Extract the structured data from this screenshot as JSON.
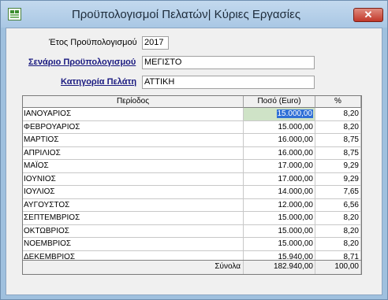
{
  "window": {
    "title": "Προϋπολογισμοί Πελατών| Κύριες Εργασίες",
    "close_glyph": "✕"
  },
  "form": {
    "year_label": "Έτος Προϋπολογισμού",
    "year_value": "2017",
    "scenario_label": "Σενάριο Προϋπολογισμού",
    "scenario_value": "ΜΕΓΙΣΤΟ",
    "category_label": "Κατηγορία Πελάτη",
    "category_value": "ΑΤΤΙΚΗ"
  },
  "grid": {
    "headers": {
      "period": "Περίοδος",
      "amount": "Ποσό (Euro)",
      "pct": "%"
    },
    "rows": [
      {
        "period": "ΙΑΝΟΥΑΡΙΟΣ",
        "amount": "15.000,00",
        "pct": "8,20"
      },
      {
        "period": "ΦΕΒΡΟΥΑΡΙΟΣ",
        "amount": "15.000,00",
        "pct": "8,20"
      },
      {
        "period": "ΜΑΡΤΙΟΣ",
        "amount": "16.000,00",
        "pct": "8,75"
      },
      {
        "period": "ΑΠΡΙΛΙΟΣ",
        "amount": "16.000,00",
        "pct": "8,75"
      },
      {
        "period": "ΜΑΪΟΣ",
        "amount": "17.000,00",
        "pct": "9,29"
      },
      {
        "period": "ΙΟΥΝΙΟΣ",
        "amount": "17.000,00",
        "pct": "9,29"
      },
      {
        "period": "ΙΟΥΛΙΟΣ",
        "amount": "14.000,00",
        "pct": "7,65"
      },
      {
        "period": "ΑΥΓΟΥΣΤΟΣ",
        "amount": "12.000,00",
        "pct": "6,56"
      },
      {
        "period": "ΣΕΠΤΕΜΒΡΙΟΣ",
        "amount": "15.000,00",
        "pct": "8,20"
      },
      {
        "period": "ΟΚΤΩΒΡΙΟΣ",
        "amount": "15.000,00",
        "pct": "8,20"
      },
      {
        "period": "ΝΟΕΜΒΡΙΟΣ",
        "amount": "15.000,00",
        "pct": "8,20"
      },
      {
        "period": "ΔΕΚΕΜΒΡΙΟΣ",
        "amount": "15.940,00",
        "pct": "8,71"
      }
    ],
    "totals": {
      "label": "Σύνολα",
      "amount": "182.940,00",
      "pct": "100,00"
    }
  }
}
